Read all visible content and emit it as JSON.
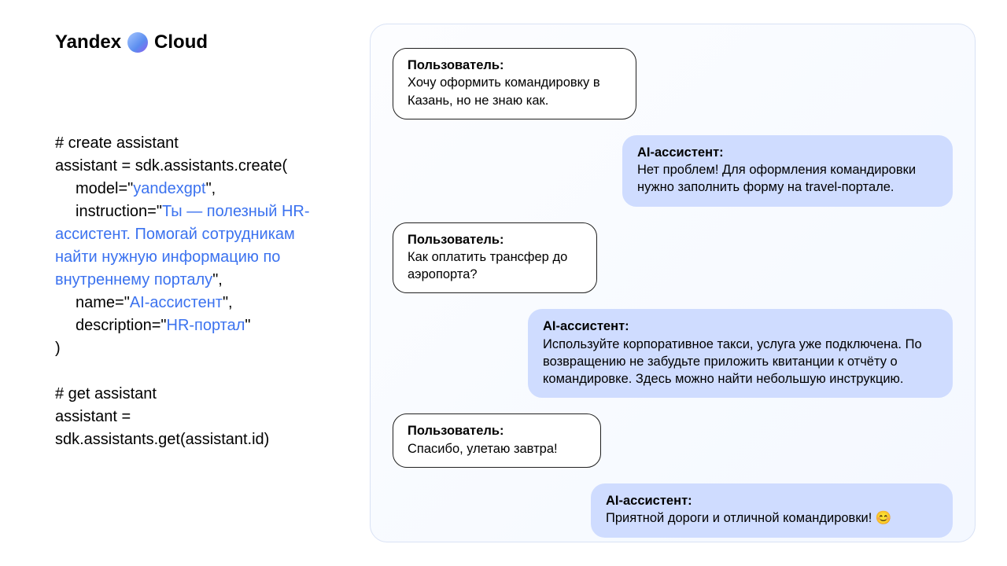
{
  "brand": {
    "word1": "Yandex",
    "word2": "Cloud"
  },
  "code": {
    "c1": "# create assistant",
    "l1": "assistant = sdk.assistants.create(",
    "l2a": "model=\"",
    "l2b": "yandexgpt",
    "l2c": "\",",
    "l3a": "instruction=\"",
    "l3b": "Ты — полезный HR-ассистент. Помогай сотрудникам найти нужную информацию по внутреннему порталу",
    "l3c": "\",",
    "l4a": "name=\"",
    "l4b": "AI-ассистент",
    "l4c": "\",",
    "l5a": "description=\"",
    "l5b": "HR-портал",
    "l5c": "\"",
    "l6": ")",
    "c2": "# get assistant",
    "l7": "assistant =",
    "l8": "sdk.assistants.get(assistant.id)"
  },
  "chat": {
    "userLabel": "Пользователь:",
    "aiLabel": "AI-ассистент:",
    "u1": "Хочу оформить командировку в Казань, но не знаю как.",
    "a1": "Нет проблем! Для оформления командировки нужно заполнить форму на travel-портале.",
    "u2": "Как оплатить трансфер до аэропорта?",
    "a2": "Используйте корпоративное такси, услуга уже подключена. По возвращению не забудьте приложить квитанции к отчёту о командировке. Здесь можно найти небольшую инструкцию.",
    "u3": "Спасибо, улетаю завтра!",
    "a3": "Приятной дороги и отличной командировки! 😊"
  }
}
